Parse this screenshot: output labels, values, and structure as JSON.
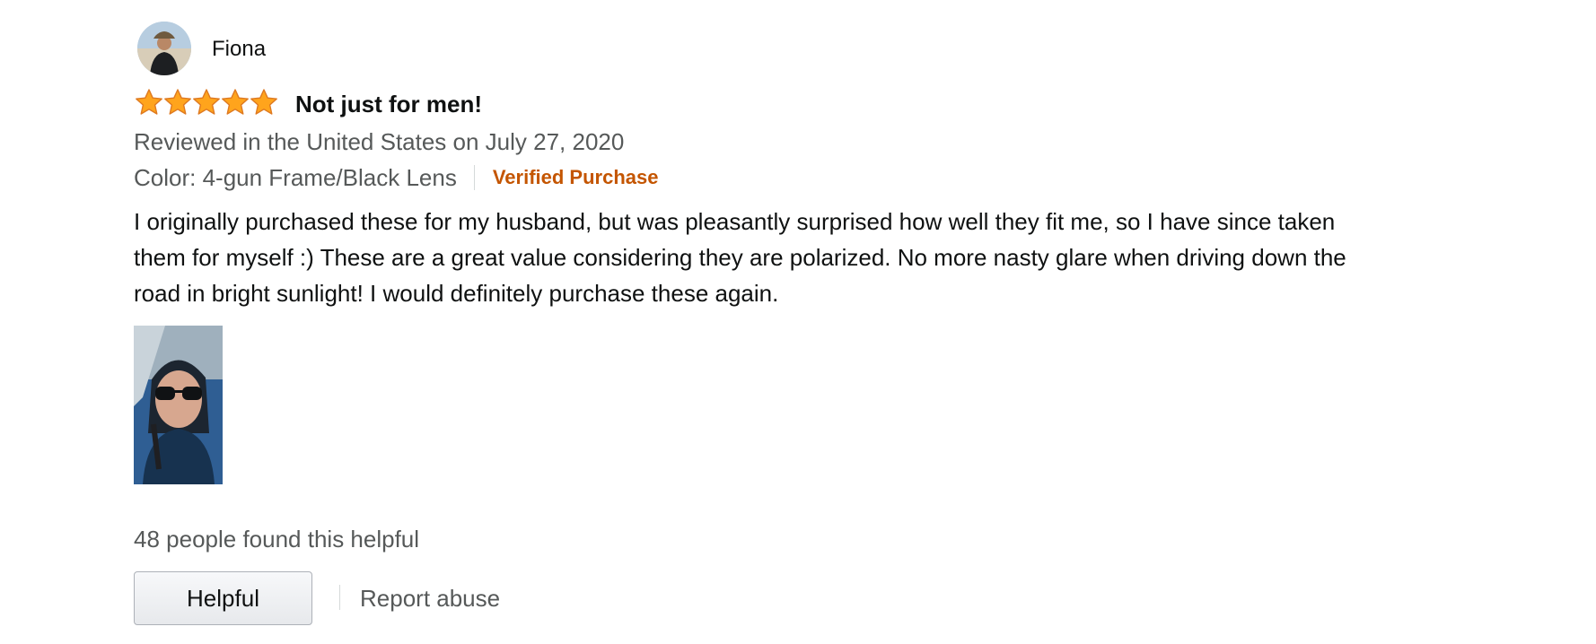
{
  "review": {
    "author": "Fiona",
    "rating": 5,
    "rating_max": 5,
    "title": "Not just for men!",
    "date_line": "Reviewed in the United States on July 27, 2020",
    "variant": "Color: 4-gun Frame/Black Lens",
    "verified": "Verified Purchase",
    "body": "I originally purchased these for my husband, but was pleasantly surprised how well they fit me, so I have since taken them for myself :) These are a great value considering they are polarized. No more nasty glare when driving down the road in bright sunlight! I would definitely purchase these again.",
    "helpful_count": "48 people found this helpful",
    "helpful_button": "Helpful",
    "report_link": "Report abuse"
  },
  "icons": {
    "star": "star-icon",
    "avatar": "user-avatar",
    "photo": "review-photo-thumbnail"
  },
  "colors": {
    "star_fill": "#ffa41c",
    "star_stroke": "#de7921",
    "verified": "#c45500",
    "muted_text": "#565959",
    "body_text": "#0f1111"
  }
}
